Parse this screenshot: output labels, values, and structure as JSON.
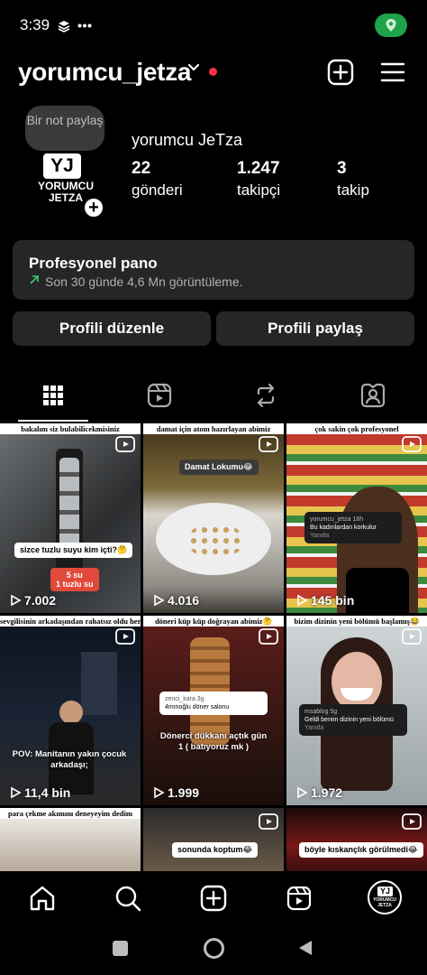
{
  "status_bar": {
    "time": "3:39",
    "extra_icons": [
      "stack-icon",
      "more-dots-icon"
    ],
    "location_badge_color": "#1fa34a"
  },
  "header": {
    "username": "yorumcu_jetza"
  },
  "profile": {
    "note": "Bir not paylaş",
    "avatar_text": [
      "YJ",
      "YORUMCU",
      "JETZA"
    ],
    "display_name": "yorumcu JeTza",
    "stats": [
      {
        "value": "22",
        "label": "gönderi"
      },
      {
        "value": "1.247",
        "label": "takipçi"
      },
      {
        "value": "3",
        "label": "takip"
      }
    ]
  },
  "pro_panel": {
    "title": "Profesyonel pano",
    "subtitle": "Son 30 günde 4,6 Mn görüntüleme."
  },
  "buttons": {
    "edit": "Profili düzenle",
    "share": "Profili paylaş"
  },
  "tabs": [
    "grid-icon",
    "reels-icon",
    "repost-icon",
    "tagged-icon"
  ],
  "grid": [
    {
      "caption": "bakalım siz bulabilicekmisiniz",
      "overlay": "sizce tuzlu suyu kim içti?🤔",
      "overlay2": "5 su\n1 tuzlu su",
      "views": "7.002"
    },
    {
      "caption": "damat için atom hazırlayan abimiz",
      "overlay": "Damat Lokumu😂",
      "views": "4.016"
    },
    {
      "caption": "çok sakin çok profesyonel",
      "comment_user": "yorumcu_jetza 16h",
      "comment_text": "Bu kadınlardan korkulur",
      "comment_reply": "Yanıtla",
      "views": "145 bin"
    },
    {
      "caption": "sevgilisinin arkadaşından rahatsız oldu herhalde",
      "overlay": "POV: Manitanın yakın çocuk arkadaşı;",
      "views": "11,4 bin"
    },
    {
      "caption": "döneri küp küp doğrayan abimiz🤔",
      "comment_user": "zenci_kara 3g",
      "comment_text": "4mınoğlu döner salonu",
      "overlay": "Dönerci dükkanı açtık gün 1 ( batıyoruz mk )",
      "views": "1.999"
    },
    {
      "caption": "bizim dizinin yeni bölümü başlamış😂",
      "comment_user": "msablog 5g",
      "comment_text": "Geldi benim dizinin yeni bölümü",
      "comment_reply": "Yanıtla",
      "views": "1.972"
    },
    {
      "caption": "para çekme akımını deneyeyim dedim",
      "views": ""
    },
    {
      "caption": "",
      "overlay": "sonunda koptum😂",
      "views": ""
    },
    {
      "caption": "",
      "overlay": "böyle kıskançlık görülmedi😂",
      "views": ""
    }
  ],
  "bottom_nav": [
    "home-icon",
    "search-icon",
    "create-icon",
    "reels-icon",
    "profile-avatar"
  ],
  "system_nav": [
    "recents-button",
    "home-button",
    "back-button"
  ]
}
